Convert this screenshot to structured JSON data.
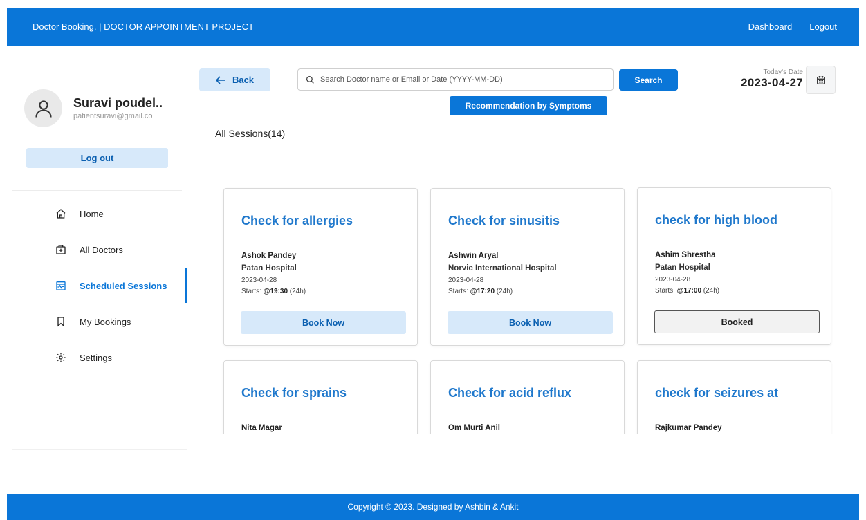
{
  "header": {
    "brand": "Doctor Booking. | DOCTOR APPOINTMENT PROJECT",
    "nav": [
      "Dashboard",
      "Logout"
    ]
  },
  "profile": {
    "name": "Suravi poudel..",
    "email": "patientsuravi@gmail.co",
    "logout_label": "Log out"
  },
  "menu": [
    {
      "label": "Home",
      "icon": "home-icon"
    },
    {
      "label": "All Doctors",
      "icon": "medical-kit-icon"
    },
    {
      "label": "Scheduled Sessions",
      "icon": "calendar-pulse-icon",
      "active": true
    },
    {
      "label": "My Bookings",
      "icon": "bookmark-icon"
    },
    {
      "label": "Settings",
      "icon": "gear-icon"
    }
  ],
  "toolbar": {
    "back_label": "Back",
    "search_placeholder": "Search Doctor name or Email or Date (YYYY-MM-DD)",
    "search_label": "Search",
    "recommend_label": "Recommendation by Symptoms",
    "today_label": "Today's Date",
    "today_value": "2023-04-27"
  },
  "sessions": {
    "title": "All Sessions(14)",
    "cards": [
      {
        "title": "Check for allergies",
        "doctor": "Ashok Pandey",
        "hospital": "Patan Hospital",
        "date": "2023-04-28",
        "starts_prefix": "Starts: ",
        "time": "@19:30",
        "time_suffix": " (24h)",
        "button": "Book Now",
        "booked": false
      },
      {
        "title": "Check for sinusitis",
        "doctor": "Ashwin Aryal",
        "hospital": "Norvic International Hospital",
        "date": "2023-04-28",
        "starts_prefix": "Starts: ",
        "time": "@17:20",
        "time_suffix": " (24h)",
        "button": "Book Now",
        "booked": false
      },
      {
        "title": "check for high blood",
        "doctor": "Ashim Shrestha",
        "hospital": "Patan Hospital",
        "date": "2023-04-28",
        "starts_prefix": "Starts: ",
        "time": "@17:00",
        "time_suffix": " (24h)",
        "button": "Booked",
        "booked": true
      },
      {
        "title": "Check for sprains",
        "doctor": "Nita Magar"
      },
      {
        "title": "Check for acid reflux",
        "doctor": "Om Murti Anil"
      },
      {
        "title": "check for seizures at",
        "doctor": "Rajkumar Pandey"
      }
    ]
  },
  "footer": {
    "text": "Copyright © 2023. Designed by Ashbin & Ankit"
  },
  "colors": {
    "primary": "#0a76d8",
    "light_button": "#d7e9fa",
    "card_title": "#1f78cc"
  }
}
